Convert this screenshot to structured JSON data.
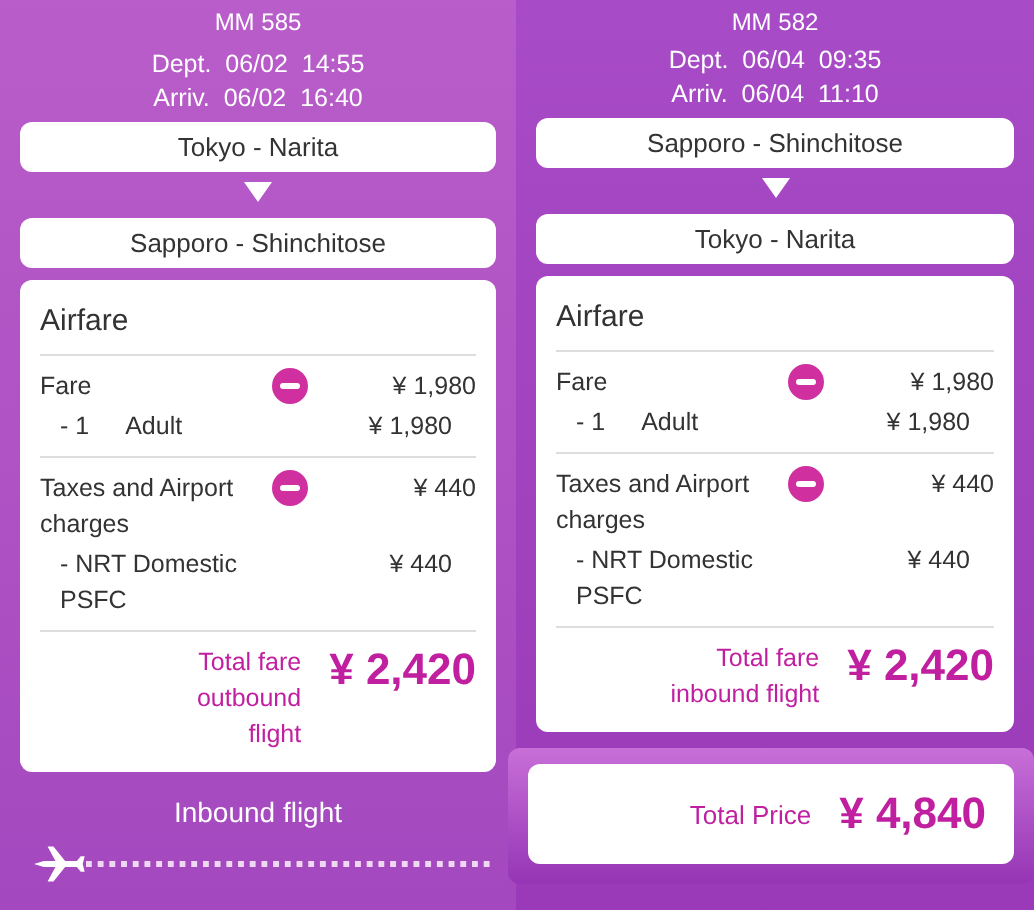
{
  "flights": [
    {
      "flight_no": "MM 585",
      "dept": "Dept.  06/02  14:55",
      "arriv": "Arriv.  06/02  16:40",
      "from": "Tokyo - Narita",
      "to": "Sapporo - Shinchitose",
      "airfare_title": "Airfare",
      "items": [
        {
          "label": "Fare",
          "amount": "¥ 1,980",
          "sub": {
            "prefix": "- 1",
            "label": "Adult",
            "amount": "¥ 1,980"
          }
        },
        {
          "label": "Taxes and Airport charges",
          "amount": "¥ 440",
          "sub": {
            "label": "- NRT Domestic PSFC",
            "amount": "¥ 440"
          }
        }
      ],
      "total_label": [
        "Total fare",
        "outbound",
        "flight"
      ],
      "total": "¥ 2,420"
    },
    {
      "flight_no": "MM 582",
      "dept": "Dept.  06/04  09:35",
      "arriv": "Arriv.  06/04  11:10",
      "from": "Sapporo - Shinchitose",
      "to": "Tokyo - Narita",
      "airfare_title": "Airfare",
      "items": [
        {
          "label": "Fare",
          "amount": "¥ 1,980",
          "sub": {
            "prefix": "- 1",
            "label": "Adult",
            "amount": "¥ 1,980"
          }
        },
        {
          "label": "Taxes and Airport charges",
          "amount": "¥ 440",
          "sub": {
            "label": "- NRT Domestic PSFC",
            "amount": "¥ 440"
          }
        }
      ],
      "total_label": [
        "Total fare",
        "inbound flight"
      ],
      "total": "¥ 2,420"
    }
  ],
  "inbound_heading": "Inbound flight",
  "total_price": {
    "label": "Total Price",
    "value": "¥ 4,840"
  }
}
